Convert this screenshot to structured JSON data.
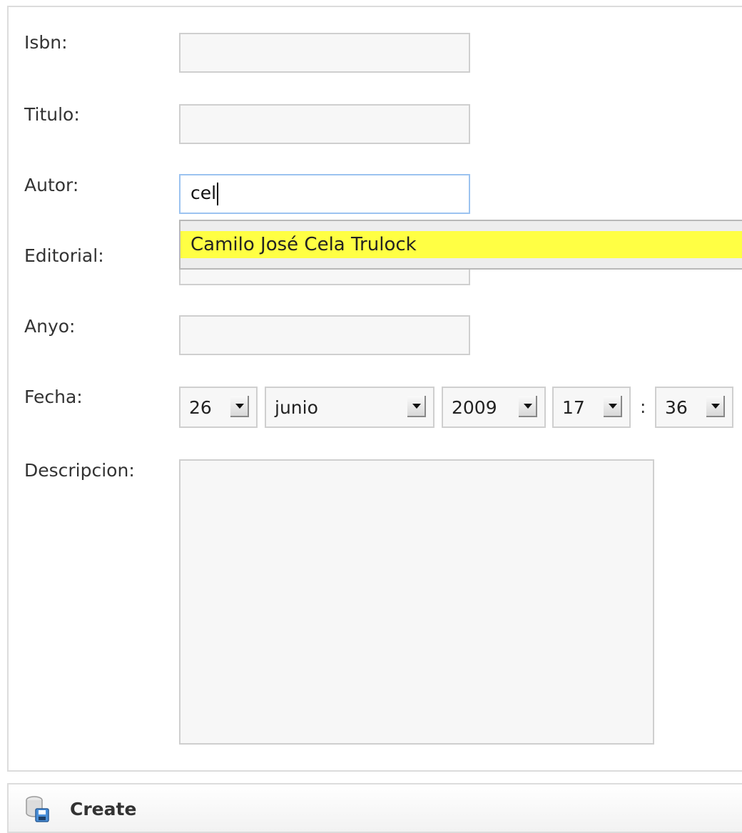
{
  "form": {
    "isbn": {
      "label": "Isbn:",
      "value": ""
    },
    "titulo": {
      "label": "Titulo:",
      "value": ""
    },
    "autor": {
      "label": "Autor:",
      "value": "cel"
    },
    "editorial": {
      "label": "Editorial:",
      "value": ""
    },
    "anyo": {
      "label": "Anyo:",
      "value": ""
    },
    "fecha": {
      "label": "Fecha:",
      "day": "26",
      "month": "junio",
      "year": "2009",
      "hour": "17",
      "separator": ":",
      "minute": "36"
    },
    "descripcion": {
      "label": "Descripcion:",
      "value": ""
    }
  },
  "autocomplete": {
    "items": [
      "Camilo José Cela Trulock"
    ],
    "highlight_color": "#ffff44"
  },
  "footer": {
    "create_label": "Create",
    "create_icon": "save-database-icon"
  },
  "colors": {
    "focus_border": "#9cc3f0",
    "field_bg": "#f7f7f7"
  }
}
